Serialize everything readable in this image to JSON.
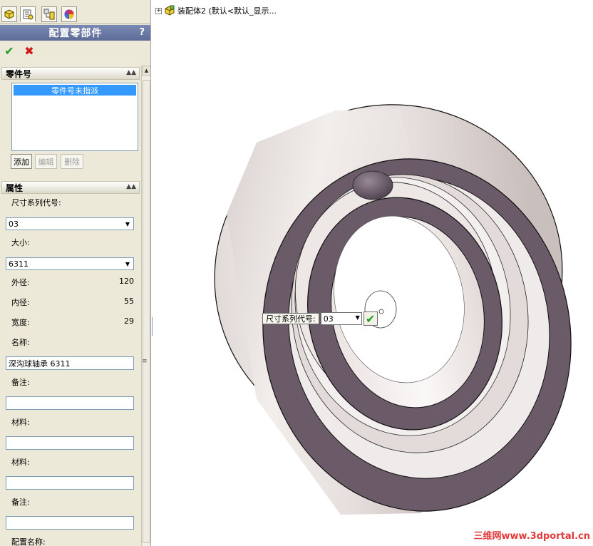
{
  "panel": {
    "title": "配置零部件",
    "help": "?",
    "ok_icon": "✔",
    "cancel_icon": "✖"
  },
  "part_number_group": {
    "title": "零件号",
    "selected_item": "零件号未指派",
    "add_label": "添加",
    "edit_label": "编辑",
    "delete_label": "删除"
  },
  "properties_group": {
    "title": "属性",
    "size_series_label": "尺寸系列代号:",
    "size_series_value": "03",
    "size_label": "大小:",
    "size_value": "6311",
    "outer_diameter_label": "外径:",
    "outer_diameter_value": "120",
    "inner_diameter_label": "内径:",
    "inner_diameter_value": "55",
    "width_label": "宽度:",
    "width_value": "29",
    "name_label": "名称:",
    "name_value": "深沟球轴承 6311",
    "remark_label_1": "备注:",
    "remark_value_1": "",
    "material_label_1": "材料:",
    "material_value_1": "",
    "material_label_2": "材料:",
    "material_value_2": "",
    "remark_label_2": "备注:",
    "remark_value_2": "",
    "config_name_label": "配置名称:"
  },
  "tree": {
    "expander": "+",
    "label": "装配体2 (默认<默认_显示..."
  },
  "dimension_popup": {
    "label": "尺寸系列代号:",
    "value": "03",
    "ok_icon": "✔"
  },
  "watermark": "三维网www.3dportal.cn",
  "colors": {
    "title_bar": "#6b79a4",
    "face_dark": "#6b5a68",
    "face_light": "#e6dfdd",
    "ok_green": "#19a01e",
    "cancel_red": "#d01616",
    "selection": "#3399ff"
  },
  "icons": {
    "tab_1": "feature-manager-icon",
    "tab_2": "property-manager-icon",
    "tab_3": "configuration-manager-icon",
    "tab_4": "display-manager-icon"
  }
}
